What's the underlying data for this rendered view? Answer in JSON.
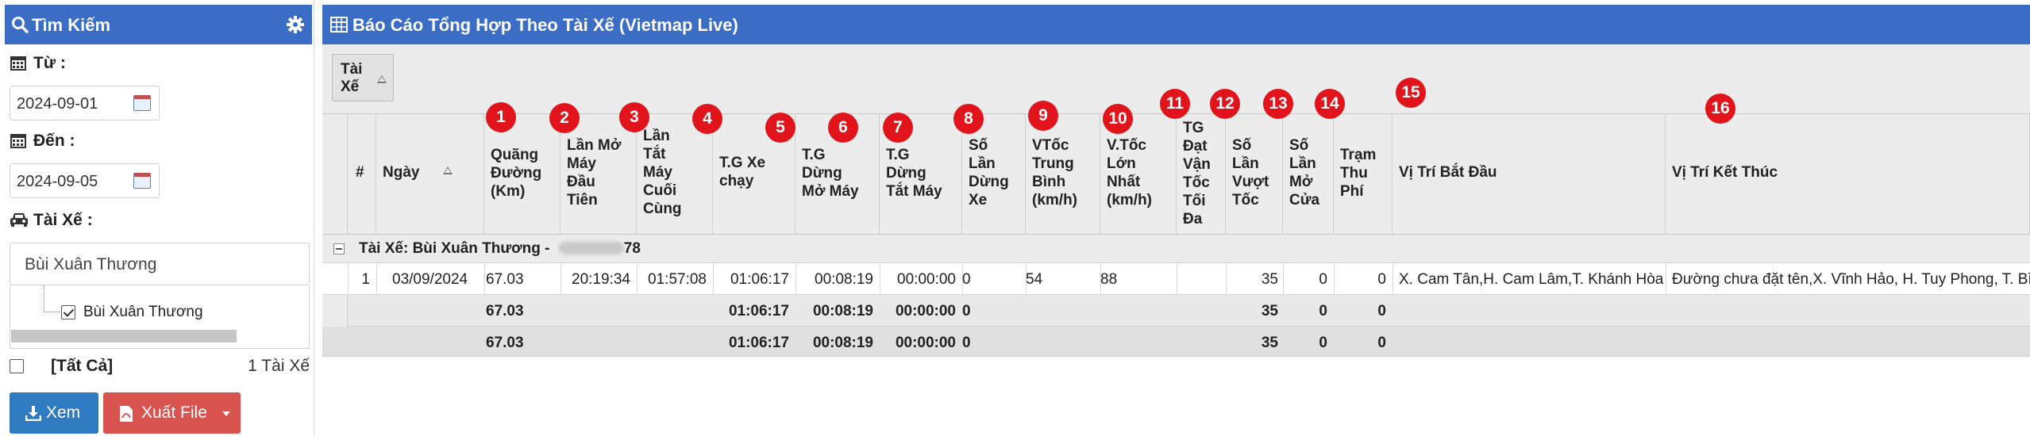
{
  "sidebar": {
    "title": "Tìm Kiếm",
    "from_label": "Từ :",
    "from_value": "2024-09-01",
    "to_label": "Đến :",
    "to_value": "2024-09-05",
    "driver_label": "Tài Xế :",
    "driver_select_value": "Bùi Xuân Thương",
    "tree_item": "Bùi Xuân Thương",
    "all_label": "[Tất Cả]",
    "driver_count": "1 Tài Xế",
    "view_button": "Xem",
    "export_button": "Xuất File"
  },
  "report": {
    "title": "Báo Cáo Tổng Hợp Theo Tài Xế (Vietmap Live)",
    "group_chip": [
      "Tài",
      "Xế"
    ],
    "columns": [
      {
        "lines": [
          "#"
        ],
        "badge": ""
      },
      {
        "lines": [
          "Ngày"
        ],
        "badge": "1"
      },
      {
        "lines": [
          "Quãng",
          "Đường",
          "(Km)"
        ],
        "badge": "2"
      },
      {
        "lines": [
          "Lần Mở",
          "Máy",
          "Đầu",
          "Tiên"
        ],
        "badge": "3"
      },
      {
        "lines": [
          "Lần",
          "Tắt",
          "Máy",
          "Cuối",
          "Cùng"
        ],
        "badge": "4"
      },
      {
        "lines": [
          "T.G Xe",
          "chạy"
        ],
        "badge": "5"
      },
      {
        "lines": [
          "T.G",
          "Dừng",
          "Mở Máy"
        ],
        "badge": "6"
      },
      {
        "lines": [
          "T.G",
          "Dừng",
          "Tắt Máy"
        ],
        "badge": "7"
      },
      {
        "lines": [
          "Số",
          "Lần",
          "Dừng",
          "Xe"
        ],
        "badge": "8"
      },
      {
        "lines": [
          "VTốc",
          "Trung",
          "Bình",
          "(km/h)"
        ],
        "badge": "9"
      },
      {
        "lines": [
          "V.Tốc",
          "Lớn",
          "Nhất",
          "(km/h)"
        ],
        "badge": "10"
      },
      {
        "lines": [
          "TG",
          "Đạt",
          "Vận",
          "Tốc",
          "Tối",
          "Đa"
        ],
        "badge": "11"
      },
      {
        "lines": [
          "Số",
          "Lần",
          "Vượt",
          "Tốc"
        ],
        "badge": "12"
      },
      {
        "lines": [
          "Số",
          "Lần",
          "Mở",
          "Cửa"
        ],
        "badge": "13"
      },
      {
        "lines": [
          "Trạm",
          "Thu",
          "Phí"
        ],
        "badge": "14"
      },
      {
        "lines": [
          "Vị Trí Bắt Đầu"
        ],
        "badge": "15"
      },
      {
        "lines": [
          "Vị Trí Kết Thúc"
        ],
        "badge": "16"
      }
    ],
    "group_row": {
      "prefix": "Tài Xế: Bùi Xuân Thương - ",
      "suffix": "78"
    },
    "rows": [
      {
        "idx": "1",
        "date": "03/09/2024",
        "distance": "67.03",
        "first_on": "20:19:34",
        "last_off": "01:57:08",
        "run_time": "01:06:17",
        "stop_on": "00:08:19",
        "stop_off": "00:00:00",
        "stops": "0",
        "avg_speed": "54",
        "max_speed": "88",
        "time_max": "",
        "overspeed": "35",
        "door": "0",
        "toll": "0",
        "start_pos": "X. Cam Tân,H. Cam Lâm,T. Khánh Hòa",
        "end_pos": "Đường chưa đặt tên,X. Vĩnh Hảo, H. Tuy Phong, T. Bình"
      }
    ],
    "subtotal": {
      "distance": "67.03",
      "run_time": "01:06:17",
      "stop_on": "00:08:19",
      "stop_off": "00:00:00",
      "stops": "0",
      "overspeed": "35",
      "door": "0",
      "toll": "0"
    },
    "total": {
      "distance": "67.03",
      "run_time": "01:06:17",
      "stop_on": "00:08:19",
      "stop_off": "00:00:00",
      "stops": "0",
      "overspeed": "35",
      "door": "0",
      "toll": "0"
    }
  }
}
